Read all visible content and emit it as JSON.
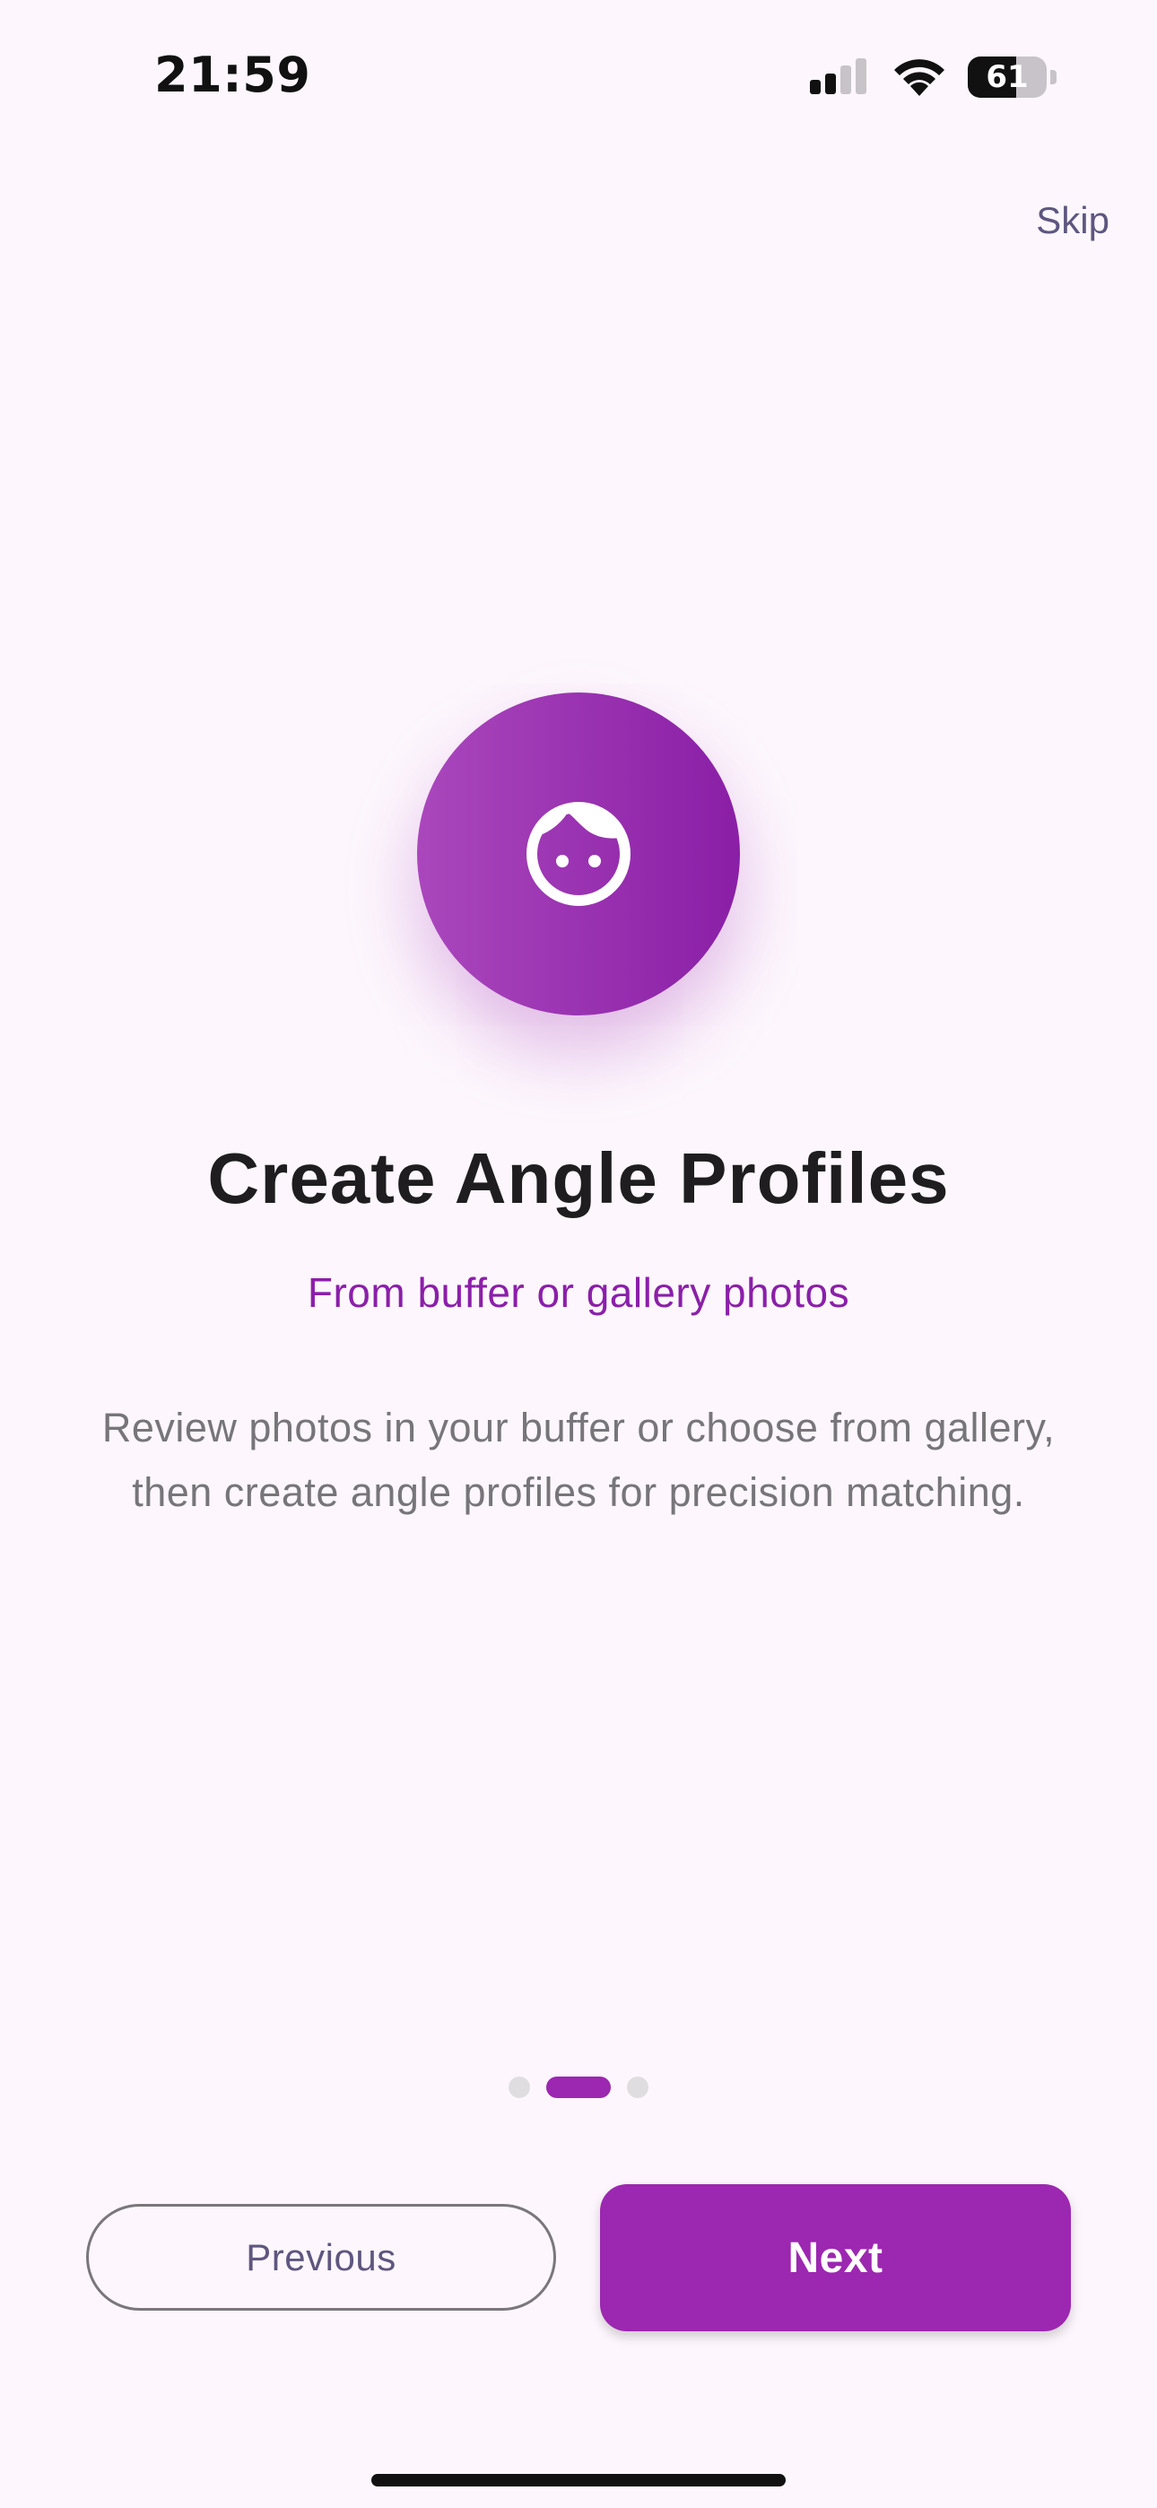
{
  "status_bar": {
    "time": "21:59",
    "battery_level": "61",
    "icons": [
      "cellular-signal-icon",
      "wifi-icon",
      "battery-icon"
    ]
  },
  "header": {
    "skip_label": "Skip"
  },
  "onboarding": {
    "hero_icon": "face-icon",
    "title": "Create Angle Profiles",
    "subtitle": "From buffer or gallery photos",
    "description": "Review photos in your buffer or choose from gallery, then create angle profiles for precision matching."
  },
  "pager": {
    "total_pages": 3,
    "current_page": 2
  },
  "actions": {
    "previous_label": "Previous",
    "next_label": "Next"
  },
  "colors": {
    "background": "#fdf7fd",
    "accent": "#9c27b0",
    "subtitle": "#8b1fa9",
    "title": "#1f1d20",
    "body_text": "#77757a",
    "secondary_text": "#5f5680"
  }
}
